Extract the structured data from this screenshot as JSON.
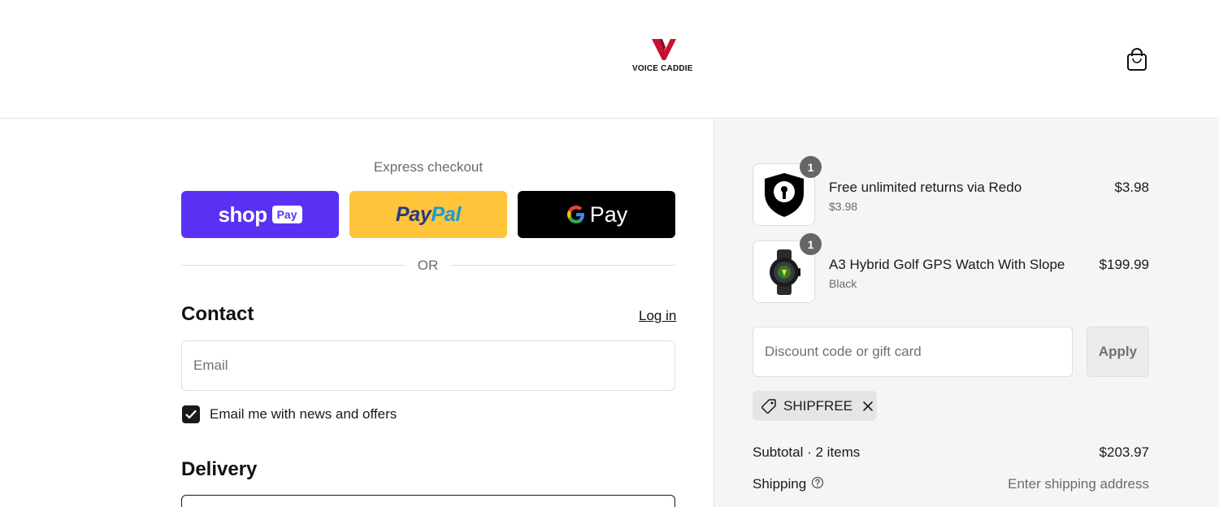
{
  "header": {
    "logo_text": "VOICE CADDIE",
    "bag_icon": "shopping-bag-icon"
  },
  "express": {
    "title": "Express checkout",
    "shop_label": "shop",
    "shop_pay_label": "Pay",
    "paypal_part1": "Pay",
    "paypal_part2": "Pal",
    "gpay_label": "Pay",
    "or_label": "OR",
    "colors": {
      "shop": "#5a31f4",
      "paypal": "#ffc439",
      "gpay": "#000000"
    }
  },
  "contact": {
    "title": "Contact",
    "login_label": "Log in",
    "email_placeholder": "Email",
    "newsletter_label": "Email me with news and offers",
    "newsletter_checked": true
  },
  "delivery": {
    "title": "Delivery"
  },
  "cart": {
    "items": [
      {
        "name": "Free unlimited returns via Redo",
        "subtitle": "$3.98",
        "price": "$3.98",
        "quantity": "1",
        "icon": "shield-keyhole-icon"
      },
      {
        "name": "A3 Hybrid Golf GPS Watch With Slope",
        "subtitle": "Black",
        "price": "$199.99",
        "quantity": "1",
        "icon": "watch-icon"
      }
    ],
    "discount_placeholder": "Discount code or gift card",
    "apply_label": "Apply",
    "applied_code": "SHIPFREE",
    "subtotal_label": "Subtotal · 2 items",
    "subtotal_value": "$203.97",
    "shipping_label": "Shipping",
    "shipping_value": "Enter shipping address"
  }
}
